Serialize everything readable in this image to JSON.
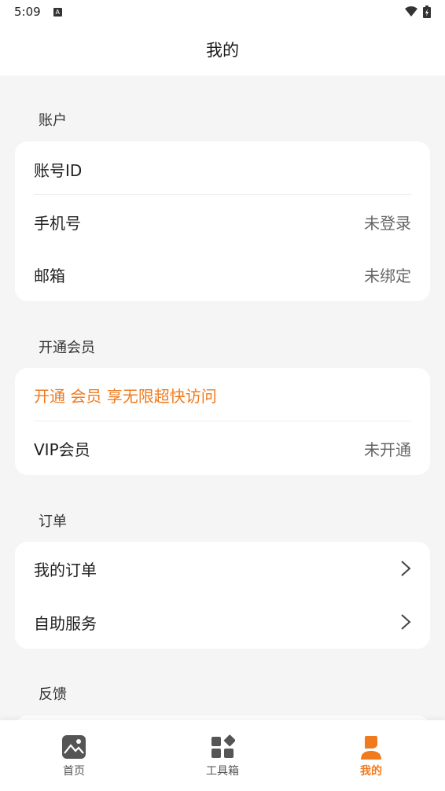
{
  "status_bar": {
    "time": "5:09",
    "notification_glyph": "A"
  },
  "app_bar": {
    "title": "我的"
  },
  "account": {
    "section_title": "账户",
    "rows": [
      {
        "label": "账号ID",
        "value": ""
      },
      {
        "label": "手机号",
        "value": "未登录"
      },
      {
        "label": "邮箱",
        "value": "未绑定"
      }
    ]
  },
  "membership": {
    "section_title": "开通会员",
    "promo": "开通 会员 享无限超快访问",
    "vip_label": "VIP会员",
    "vip_value": "未开通"
  },
  "orders": {
    "section_title": "订单",
    "rows": [
      {
        "label": "我的订单"
      },
      {
        "label": "自助服务"
      }
    ]
  },
  "feedback": {
    "section_title": "反馈"
  },
  "bottom_nav": {
    "items": [
      {
        "label": "首页",
        "icon": "image-icon",
        "active": false
      },
      {
        "label": "工具箱",
        "icon": "toolbox-icon",
        "active": false
      },
      {
        "label": "我的",
        "icon": "person-icon",
        "active": true
      }
    ]
  },
  "colors": {
    "accent": "#f07a1e",
    "background": "#f5f5f5",
    "card": "#ffffff"
  }
}
